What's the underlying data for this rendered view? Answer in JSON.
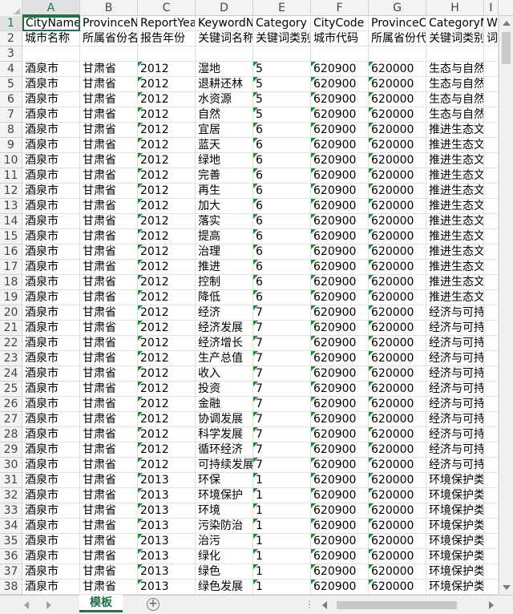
{
  "columns": [
    "A",
    "B",
    "C",
    "D",
    "E",
    "F",
    "G",
    "H",
    "I"
  ],
  "header_row": [
    "CityName",
    "ProvinceNa",
    "ReportYea",
    "KeywordN",
    "Category",
    "CityCode",
    "ProvinceCo",
    "CategoryN",
    "W"
  ],
  "desc_row": [
    "城市名称",
    "所属省份名",
    "报告年份",
    "关键词名称",
    "关键词类别",
    "城市代码",
    "所属省份代",
    "关键词类别",
    "词"
  ],
  "row_numbers": [
    1,
    2,
    3,
    4,
    5,
    6,
    7,
    8,
    9,
    10,
    11,
    12,
    13,
    14,
    15,
    16,
    17,
    18,
    19,
    20,
    21,
    22,
    23,
    24,
    25,
    26,
    27,
    28,
    29,
    30,
    31,
    32,
    33,
    34,
    35,
    36,
    37,
    38
  ],
  "data_rows": [
    [
      "酒泉市",
      "甘肃省",
      "2012",
      "湿地",
      "5",
      "620900",
      "620000",
      "生态与自然"
    ],
    [
      "酒泉市",
      "甘肃省",
      "2012",
      "退耕还林",
      "5",
      "620900",
      "620000",
      "生态与自然"
    ],
    [
      "酒泉市",
      "甘肃省",
      "2012",
      "水资源",
      "5",
      "620900",
      "620000",
      "生态与自然"
    ],
    [
      "酒泉市",
      "甘肃省",
      "2012",
      "自然",
      "5",
      "620900",
      "620000",
      "生态与自然"
    ],
    [
      "酒泉市",
      "甘肃省",
      "2012",
      "宜居",
      "6",
      "620900",
      "620000",
      "推进生态文"
    ],
    [
      "酒泉市",
      "甘肃省",
      "2012",
      "蓝天",
      "6",
      "620900",
      "620000",
      "推进生态文"
    ],
    [
      "酒泉市",
      "甘肃省",
      "2012",
      "绿地",
      "6",
      "620900",
      "620000",
      "推进生态文"
    ],
    [
      "酒泉市",
      "甘肃省",
      "2012",
      "完善",
      "6",
      "620900",
      "620000",
      "推进生态文"
    ],
    [
      "酒泉市",
      "甘肃省",
      "2012",
      "再生",
      "6",
      "620900",
      "620000",
      "推进生态文"
    ],
    [
      "酒泉市",
      "甘肃省",
      "2012",
      "加大",
      "6",
      "620900",
      "620000",
      "推进生态文"
    ],
    [
      "酒泉市",
      "甘肃省",
      "2012",
      "落实",
      "6",
      "620900",
      "620000",
      "推进生态文"
    ],
    [
      "酒泉市",
      "甘肃省",
      "2012",
      "提高",
      "6",
      "620900",
      "620000",
      "推进生态文"
    ],
    [
      "酒泉市",
      "甘肃省",
      "2012",
      "治理",
      "6",
      "620900",
      "620000",
      "推进生态文"
    ],
    [
      "酒泉市",
      "甘肃省",
      "2012",
      "推进",
      "6",
      "620900",
      "620000",
      "推进生态文"
    ],
    [
      "酒泉市",
      "甘肃省",
      "2012",
      "控制",
      "6",
      "620900",
      "620000",
      "推进生态文"
    ],
    [
      "酒泉市",
      "甘肃省",
      "2012",
      "降低",
      "6",
      "620900",
      "620000",
      "推进生态文"
    ],
    [
      "酒泉市",
      "甘肃省",
      "2012",
      "经济",
      "7",
      "620900",
      "620000",
      "经济与可持"
    ],
    [
      "酒泉市",
      "甘肃省",
      "2012",
      "经济发展",
      "7",
      "620900",
      "620000",
      "经济与可持"
    ],
    [
      "酒泉市",
      "甘肃省",
      "2012",
      "经济增长",
      "7",
      "620900",
      "620000",
      "经济与可持"
    ],
    [
      "酒泉市",
      "甘肃省",
      "2012",
      "生产总值",
      "7",
      "620900",
      "620000",
      "经济与可持"
    ],
    [
      "酒泉市",
      "甘肃省",
      "2012",
      "收入",
      "7",
      "620900",
      "620000",
      "经济与可持"
    ],
    [
      "酒泉市",
      "甘肃省",
      "2012",
      "投资",
      "7",
      "620900",
      "620000",
      "经济与可持"
    ],
    [
      "酒泉市",
      "甘肃省",
      "2012",
      "金融",
      "7",
      "620900",
      "620000",
      "经济与可持"
    ],
    [
      "酒泉市",
      "甘肃省",
      "2012",
      "协调发展",
      "7",
      "620900",
      "620000",
      "经济与可持"
    ],
    [
      "酒泉市",
      "甘肃省",
      "2012",
      "科学发展",
      "7",
      "620900",
      "620000",
      "经济与可持"
    ],
    [
      "酒泉市",
      "甘肃省",
      "2012",
      "循环经济",
      "7",
      "620900",
      "620000",
      "经济与可持"
    ],
    [
      "酒泉市",
      "甘肃省",
      "2012",
      "可持续发展",
      "7",
      "620900",
      "620000",
      "经济与可持"
    ],
    [
      "酒泉市",
      "甘肃省",
      "2013",
      "环保",
      "1",
      "620900",
      "620000",
      "环境保护类"
    ],
    [
      "酒泉市",
      "甘肃省",
      "2013",
      "环境保护",
      "1",
      "620900",
      "620000",
      "环境保护类"
    ],
    [
      "酒泉市",
      "甘肃省",
      "2013",
      "环境",
      "1",
      "620900",
      "620000",
      "环境保护类"
    ],
    [
      "酒泉市",
      "甘肃省",
      "2013",
      "污染防治",
      "1",
      "620900",
      "620000",
      "环境保护类"
    ],
    [
      "酒泉市",
      "甘肃省",
      "2013",
      "治污",
      "1",
      "620900",
      "620000",
      "环境保护类"
    ],
    [
      "酒泉市",
      "甘肃省",
      "2013",
      "绿化",
      "1",
      "620900",
      "620000",
      "环境保护类"
    ],
    [
      "酒泉市",
      "甘肃省",
      "2013",
      "绿色",
      "1",
      "620900",
      "620000",
      "环境保护类"
    ],
    [
      "酒泉市",
      "甘肃省",
      "2013",
      "绿色发展",
      "1",
      "620900",
      "620000",
      "环境保护类"
    ]
  ],
  "sheet_tab": "模板",
  "add_sheet_symbol": "+",
  "split_dots": "⋮",
  "colors": {
    "accent": "#217346",
    "error_triangle": "#1e8a3c",
    "grid": "#e0e0e0",
    "header_bg": "#f3f3f3"
  }
}
